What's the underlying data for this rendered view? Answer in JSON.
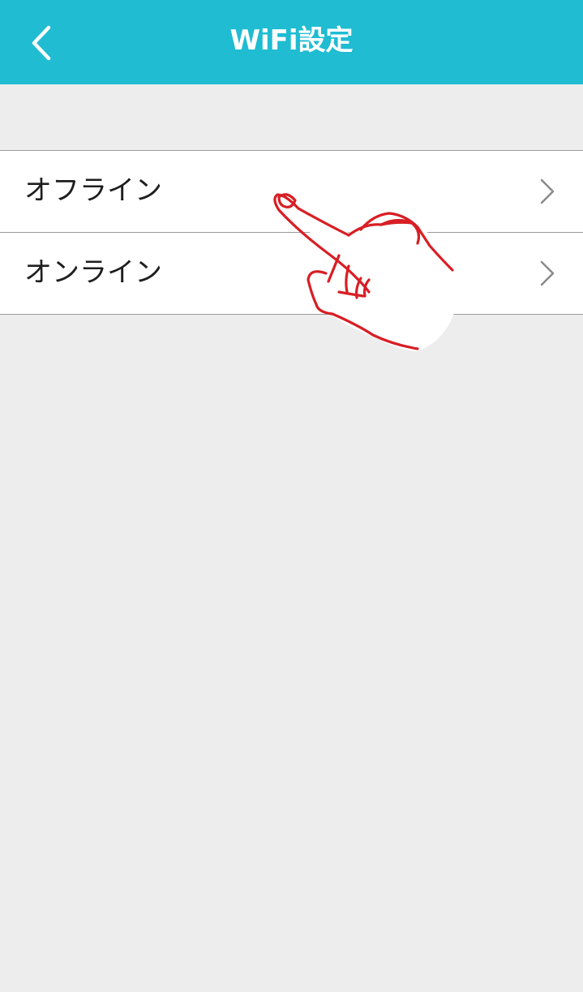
{
  "header": {
    "title": "WiFi設定",
    "back_icon": "chevron-left-icon",
    "background_color": "#1fbcd2"
  },
  "settings_list": {
    "items": [
      {
        "label": "オフライン",
        "icon": "chevron-right-icon"
      },
      {
        "label": "オンライン",
        "icon": "chevron-right-icon"
      }
    ]
  },
  "overlay": {
    "icon": "tap-hand-icon",
    "stroke_color": "#d81e24"
  }
}
